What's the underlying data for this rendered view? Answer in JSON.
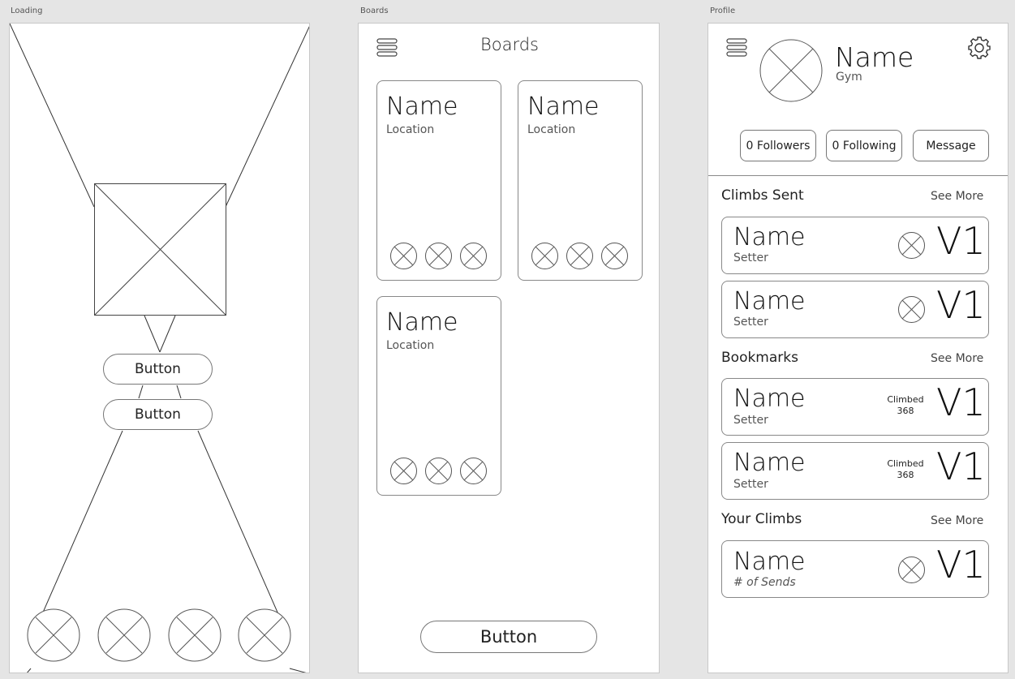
{
  "frames": {
    "loading": {
      "label": "Loading",
      "buttons": [
        "Button",
        "Button"
      ]
    },
    "boards": {
      "label": "Boards",
      "title": "Boards",
      "cards": [
        {
          "name": "Name",
          "location": "Location"
        },
        {
          "name": "Name",
          "location": "Location"
        },
        {
          "name": "Name",
          "location": "Location"
        }
      ],
      "button": "Button"
    },
    "profile": {
      "label": "Profile",
      "user": {
        "name": "Name",
        "gym": "Gym"
      },
      "stats": {
        "followers": "0 Followers",
        "following": "0 Following",
        "message": "Message"
      },
      "sections": {
        "sent": {
          "title": "Climbs Sent",
          "see_more": "See More",
          "items": [
            {
              "name": "Name",
              "setter": "Setter",
              "grade": "V1"
            },
            {
              "name": "Name",
              "setter": "Setter",
              "grade": "V1"
            }
          ]
        },
        "bookmarks": {
          "title": "Bookmarks",
          "see_more": "See More",
          "items": [
            {
              "name": "Name",
              "setter": "Setter",
              "climbed_label": "Climbed",
              "climbed_count": "368",
              "grade": "V1"
            },
            {
              "name": "Name",
              "setter": "Setter",
              "climbed_label": "Climbed",
              "climbed_count": "368",
              "grade": "V1"
            }
          ]
        },
        "yours": {
          "title": "Your Climbs",
          "see_more": "See More",
          "items": [
            {
              "name": "Name",
              "sends": "# of Sends",
              "grade": "V1"
            }
          ]
        }
      }
    }
  },
  "colors": {
    "background": "#e5e5e5",
    "artboard": "#ffffff",
    "stroke": "#777777"
  },
  "icons": [
    "hamburger-icon",
    "settings-gear-icon",
    "image-placeholder-icon",
    "avatar-placeholder-icon"
  ]
}
